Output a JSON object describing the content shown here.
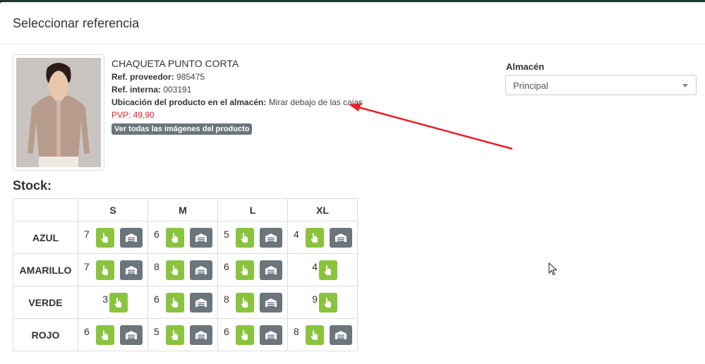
{
  "modal": {
    "title": "Seleccionar referencia"
  },
  "product": {
    "name": "CHAQUETA PUNTO CORTA",
    "supplier_ref_label": "Ref. proveedor:",
    "supplier_ref": "985475",
    "internal_ref_label": "Ref. interna:",
    "internal_ref": "003191",
    "location_label": "Ubicación del producto en el almacén:",
    "location": "Mirar debajo de las cajas",
    "price": "PVP: 49,90",
    "images_button": "Ver todas las imágenes del producto"
  },
  "warehouse": {
    "label": "Almacén",
    "selected": "Principal"
  },
  "stock": {
    "title": "Stock:",
    "sizes": [
      "S",
      "M",
      "L",
      "XL"
    ],
    "rows": [
      {
        "color": "AZUL",
        "cells": [
          {
            "qty": "7",
            "store": true
          },
          {
            "qty": "6",
            "store": true
          },
          {
            "qty": "5",
            "store": true
          },
          {
            "qty": "4",
            "store": true
          }
        ]
      },
      {
        "color": "AMARILLO",
        "cells": [
          {
            "qty": "7",
            "store": true
          },
          {
            "qty": "8",
            "store": true
          },
          {
            "qty": "6",
            "store": true
          },
          {
            "qty": "4",
            "store": false
          }
        ]
      },
      {
        "color": "VERDE",
        "cells": [
          {
            "qty": "3",
            "store": false
          },
          {
            "qty": "6",
            "store": true
          },
          {
            "qty": "8",
            "store": true
          },
          {
            "qty": "9",
            "store": false
          }
        ]
      },
      {
        "color": "ROJO",
        "cells": [
          {
            "qty": "6",
            "store": true
          },
          {
            "qty": "5",
            "store": true
          },
          {
            "qty": "6",
            "store": true
          },
          {
            "qty": "8",
            "store": true
          }
        ]
      }
    ]
  },
  "icons": {
    "select": "hand-pointer-icon",
    "warehouse": "warehouse-icon"
  },
  "colors": {
    "green": "#8ac43f",
    "gray": "#6b757c",
    "price": "#e8212b",
    "arrow": "#e8212b"
  }
}
